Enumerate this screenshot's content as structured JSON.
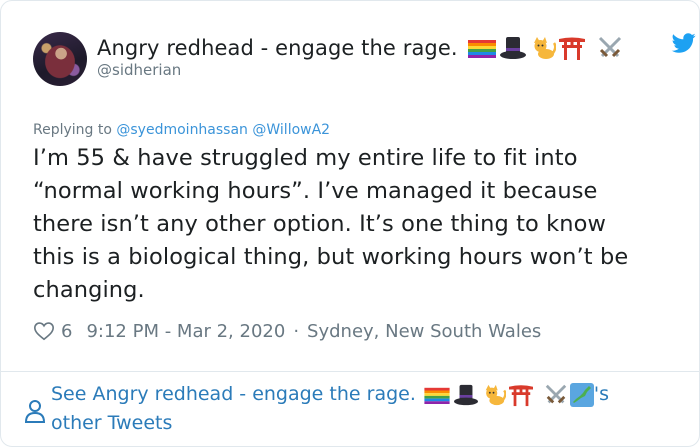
{
  "author": {
    "name": "Angry redhead - engage the rage.",
    "handle": "@sidherian",
    "name_emojis": [
      "rainbow-flag-icon",
      "top-hat-icon",
      "cat-icon",
      "torii-gate-icon",
      "crossed-swords-icon"
    ]
  },
  "reply": {
    "prefix": "Replying to",
    "mentions": "@syedmoinhassan @WillowA2"
  },
  "tweet": {
    "lines": [
      "I’m 55 & have struggled my entire life to fit into",
      "“normal working hours”. I’ve managed it because",
      "there isn’t any other option. It’s one thing to know",
      "this is a biological thing, but working hours won’t be",
      "changing."
    ]
  },
  "meta": {
    "likes": "6",
    "timestamp": "9:12 PM - Mar 2, 2020",
    "separator": "·",
    "location": "Sydney, New South Wales"
  },
  "footer": {
    "prefix": "See Angry redhead - engage the rage.",
    "possessive": "'s",
    "second_line": "other Tweets",
    "emojis": [
      "rainbow-flag-icon",
      "top-hat-icon",
      "cat-icon",
      "torii-gate-icon",
      "crossed-swords-icon",
      "japan-map-icon"
    ]
  },
  "colors": {
    "link": "#2b7bb9",
    "muted": "#697882",
    "twitter_blue": "#1da1f2",
    "text": "#1c2022"
  }
}
